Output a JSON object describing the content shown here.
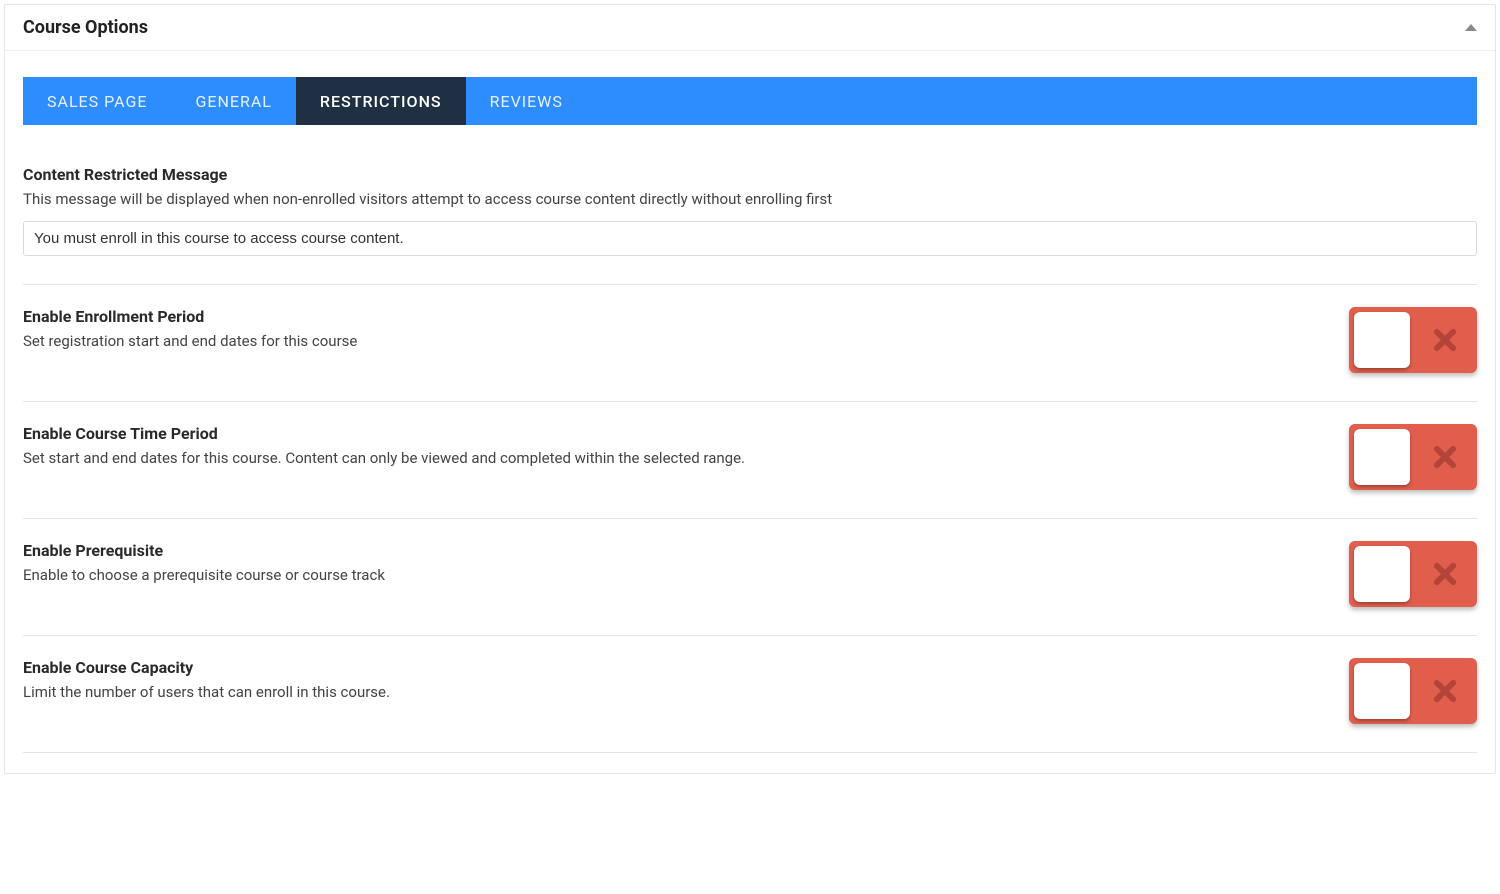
{
  "panel_title": "Course Options",
  "tabs": [
    {
      "label": "SALES PAGE"
    },
    {
      "label": "GENERAL"
    },
    {
      "label": "RESTRICTIONS"
    },
    {
      "label": "REVIEWS"
    }
  ],
  "active_tab_index": 2,
  "restricted_message": {
    "title": "Content Restricted Message",
    "desc": "This message will be displayed when non-enrolled visitors attempt to access course content directly without enrolling first",
    "value": "You must enroll in this course to access course content."
  },
  "options": [
    {
      "title": "Enable Enrollment Period",
      "desc": "Set registration start and end dates for this course",
      "on": false
    },
    {
      "title": "Enable Course Time Period",
      "desc": "Set start and end dates for this course. Content can only be viewed and completed within the selected range.",
      "on": false
    },
    {
      "title": "Enable Prerequisite",
      "desc": "Enable to choose a prerequisite course or course track",
      "on": false
    },
    {
      "title": "Enable Course Capacity",
      "desc": "Limit the number of users that can enroll in this course.",
      "on": false
    }
  ]
}
